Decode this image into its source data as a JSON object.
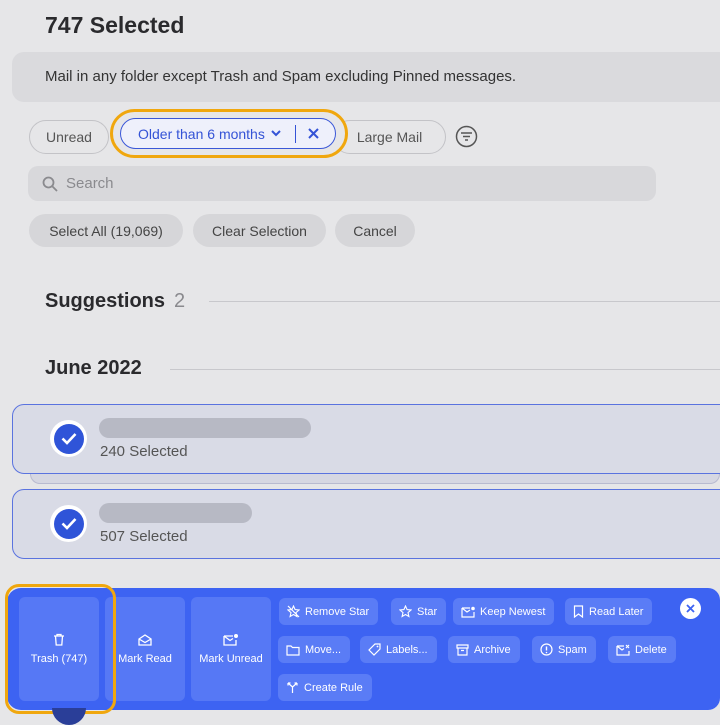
{
  "header": {
    "title": "747 Selected",
    "description": "Mail in any folder except Trash and Spam excluding Pinned messages."
  },
  "filters": {
    "unread": "Unread",
    "age": "Older than 6 months",
    "large": "Large Mail"
  },
  "search": {
    "placeholder": "Search"
  },
  "selection_actions": {
    "select_all": "Select All (19,069)",
    "clear": "Clear Selection",
    "cancel": "Cancel"
  },
  "sections": {
    "suggestions": {
      "label": "Suggestions",
      "count": "2"
    },
    "month": {
      "label": "June 2022"
    }
  },
  "groups": [
    {
      "selected": "240 Selected"
    },
    {
      "selected": "507 Selected"
    }
  ],
  "toolbar": {
    "trash": "Trash (747)",
    "mark_read": "Mark Read",
    "mark_unread": "Mark Unread",
    "remove_star": "Remove Star",
    "star": "Star",
    "keep_newest": "Keep Newest",
    "read_later": "Read Later",
    "move": "Move...",
    "labels": "Labels...",
    "archive": "Archive",
    "spam": "Spam",
    "delete": "Delete",
    "create_rule": "Create Rule"
  },
  "colors": {
    "accent": "#3d63f2",
    "highlight": "#f0a70e",
    "background": "#e6e6e8"
  }
}
